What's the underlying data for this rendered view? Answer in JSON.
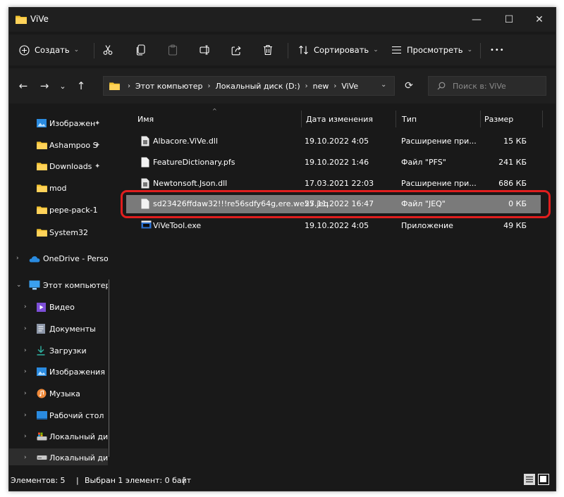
{
  "window": {
    "title": "ViVe",
    "controls": {
      "minimize": "—",
      "maximize": "☐",
      "close": "✕"
    }
  },
  "command_bar": {
    "create_label": "Создать",
    "sort_label": "Сортировать",
    "view_label": "Просмотреть",
    "more_label": "•••"
  },
  "address_bar": {
    "breadcrumb": [
      "Этот компьютер",
      "Локальный диск (D:)",
      "new",
      "ViVe"
    ],
    "search_placeholder": "Поиск в: ViVe"
  },
  "sidebar": {
    "items": [
      {
        "label": "Изображен",
        "icon": "pictures-icon",
        "pinned": true
      },
      {
        "label": "Ashampoo S",
        "icon": "folder-icon",
        "pinned": true
      },
      {
        "label": "Downloads",
        "icon": "folder-icon",
        "pinned": true
      },
      {
        "label": "mod",
        "icon": "folder-icon",
        "pinned": false
      },
      {
        "label": "pepe-pack-1",
        "icon": "folder-icon",
        "pinned": false
      },
      {
        "label": "System32",
        "icon": "folder-icon",
        "pinned": false
      },
      {
        "label": "OneDrive - Perso",
        "icon": "onedrive-icon",
        "pinned": false
      },
      {
        "label": "Этот компьютер",
        "icon": "this-pc-icon",
        "pinned": false
      },
      {
        "label": "Видео",
        "icon": "videos-icon",
        "pinned": false
      },
      {
        "label": "Документы",
        "icon": "documents-icon",
        "pinned": false
      },
      {
        "label": "Загрузки",
        "icon": "downloads-icon",
        "pinned": false
      },
      {
        "label": "Изображения",
        "icon": "pictures-icon",
        "pinned": false
      },
      {
        "label": "Музыка",
        "icon": "music-icon",
        "pinned": false
      },
      {
        "label": "Рабочий стол",
        "icon": "desktop-icon",
        "pinned": false
      },
      {
        "label": "Локальный ди",
        "icon": "drive-c-icon",
        "pinned": false
      },
      {
        "label": "Локальный ди",
        "icon": "drive-d-icon",
        "pinned": false
      }
    ]
  },
  "file_list": {
    "columns": {
      "name": "Имя",
      "date": "Дата изменения",
      "type": "Тип",
      "size": "Размер"
    },
    "rows": [
      {
        "name": "Albacore.ViVe.dll",
        "date": "19.10.2022 4:05",
        "type": "Расширение при...",
        "size": "15 КБ",
        "icon": "dll-file-icon"
      },
      {
        "name": "FeatureDictionary.pfs",
        "date": "19.10.2022 1:46",
        "type": "Файл \"PFS\"",
        "size": "241 КБ",
        "icon": "file-icon"
      },
      {
        "name": "Newtonsoft.Json.dll",
        "date": "17.03.2021 22:03",
        "type": "Расширение при...",
        "size": "686 КБ",
        "icon": "dll-file-icon"
      },
      {
        "name": "sd23426ffdaw32!!!re56sdfy64g,ere.we55.jeq",
        "date": "27.11.2022 16:47",
        "type": "Файл \"JEQ\"",
        "size": "0 КБ",
        "icon": "file-icon"
      },
      {
        "name": "ViVeTool.exe",
        "date": "19.10.2022 4:05",
        "type": "Приложение",
        "size": "49 КБ",
        "icon": "exe-file-icon"
      }
    ]
  },
  "status_bar": {
    "items_count": "Элементов: 5",
    "selection": "Выбран 1 элемент: 0 байт"
  },
  "colors": {
    "highlight": "#e01e1e",
    "folder": "#f4c430",
    "selected_row": "#7a7a7a"
  }
}
